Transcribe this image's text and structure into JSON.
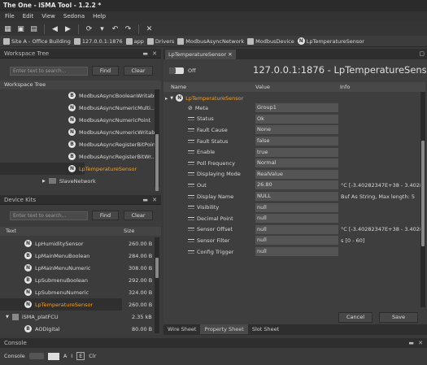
{
  "window": {
    "title": "The One - iSMA Tool - 1.2.2 *"
  },
  "menu": [
    "File",
    "Edit",
    "View",
    "Sedona",
    "Help"
  ],
  "breadcrumb": [
    {
      "label": "Site A - Office Building"
    },
    {
      "label": "127.0.0.1:1876"
    },
    {
      "label": "app"
    },
    {
      "label": "Drivers"
    },
    {
      "label": "ModbusAsyncNetwork"
    },
    {
      "label": "ModbusDevice"
    },
    {
      "label": "LpTemperatureSensor"
    }
  ],
  "workspace": {
    "header": "Workspace Tree",
    "search_placeholder": "Enter text to search...",
    "find_label": "Find",
    "clear_label": "Clear",
    "tree_header": "Workspace Tree",
    "items": [
      {
        "label": "ModbusAsyncBooleanWritable"
      },
      {
        "label": "ModbusAsyncNumericMulti..."
      },
      {
        "label": "ModbusAsyncNumericPoint"
      },
      {
        "label": "ModbusAsyncNumericWritable"
      },
      {
        "label": "ModbusAsyncRegisterBitPoint"
      },
      {
        "label": "ModbusAsyncRegisterBitWr..."
      },
      {
        "label": "LpTemperatureSensor"
      }
    ],
    "slave_network": "SlaveNetwork"
  },
  "devicekits": {
    "header": "Device Kits",
    "search_placeholder": "Enter text to search...",
    "find_label": "Find",
    "clear_label": "Clear",
    "col_text": "Text",
    "col_size": "Size",
    "items": [
      {
        "label": "LpHumiditySensor",
        "size": "260.00 B"
      },
      {
        "label": "LpMainMenuBoolean",
        "size": "284.00 B"
      },
      {
        "label": "LpMainMenuNumeric",
        "size": "308.00 B"
      },
      {
        "label": "LpSubmenuBoolean",
        "size": "292.00 B"
      },
      {
        "label": "LpSubmenuNumeric",
        "size": "324.00 B"
      },
      {
        "label": "LpTemperatureSensor",
        "size": "260.00 B"
      }
    ],
    "group": {
      "label": "iSMA_platFCU",
      "size": "2.35 kB"
    },
    "group_item": {
      "label": "AODigital",
      "size": "80.00 B"
    }
  },
  "editor": {
    "tab": "LpTemperatureSensor",
    "toggle_label": "Off",
    "title": "127.0.0.1:1876 - LpTemperatureSensor [iSMA",
    "col_name": "Name",
    "col_value": "Value",
    "col_info": "Info",
    "component": "LpTemperatureSensor",
    "rows": [
      {
        "name": "Meta",
        "value": "Group1",
        "info": ""
      },
      {
        "name": "Status",
        "value": "Ok",
        "info": ""
      },
      {
        "name": "Fault Cause",
        "value": "None",
        "info": ""
      },
      {
        "name": "Fault Status",
        "value": "false",
        "info": ""
      },
      {
        "name": "Enable",
        "value": "true",
        "info": ""
      },
      {
        "name": "Poll Frequency",
        "value": "Normal",
        "info": ""
      },
      {
        "name": "Displaying Mode",
        "value": "RealValue",
        "info": ""
      },
      {
        "name": "Out",
        "value": "26.80",
        "info": "°C  [-3.40282347E+38 - 3.40282..."
      },
      {
        "name": "Display Name",
        "value": "NULL",
        "info": "Buf As String, Max length: 5"
      },
      {
        "name": "Visibility",
        "value": "null",
        "info": ""
      },
      {
        "name": "Decimal Point",
        "value": "null",
        "info": ""
      },
      {
        "name": "Sensor Offset",
        "value": "null",
        "info": "°C  [-3.40282347E+38 - 3.40282..."
      },
      {
        "name": "Sensor Filter",
        "value": "null",
        "info": "s  [0 - 60]"
      },
      {
        "name": "Config Trigger",
        "value": "null",
        "info": ""
      }
    ],
    "cancel_label": "Cancel",
    "save_label": "Save",
    "bottom_tabs": [
      "Wire Sheet",
      "Property Sheet",
      "Slot Sheet"
    ]
  },
  "console": {
    "header": "Console",
    "label": "Console",
    "btn_a": "A",
    "btn_i": "I",
    "btn_e": "E",
    "btn_clr": "Clr"
  },
  "colors": {
    "accent": "#f0a030"
  }
}
